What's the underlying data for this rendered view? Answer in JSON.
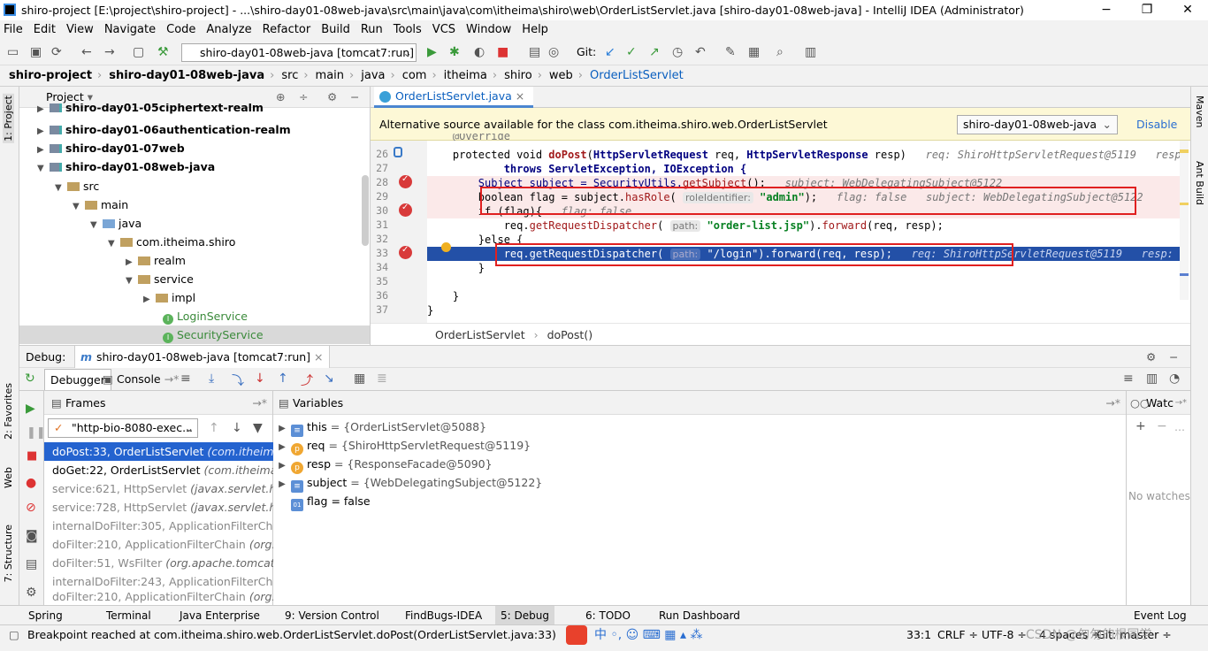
{
  "window": {
    "title": "shiro-project [E:\\project\\shiro-project] - ...\\shiro-day01-08web-java\\src\\main\\java\\com\\itheima\\shiro\\web\\OrderListServlet.java [shiro-day01-08web-java] - IntelliJ IDEA (Administrator)",
    "minimize": "−",
    "maximize": "❐",
    "close": "✕"
  },
  "menu": [
    "File",
    "Edit",
    "View",
    "Navigate",
    "Code",
    "Analyze",
    "Refactor",
    "Build",
    "Run",
    "Tools",
    "VCS",
    "Window",
    "Help"
  ],
  "toolbar": {
    "run_config": "shiro-day01-08web-java [tomcat7:run]",
    "git_label": "Git:"
  },
  "breadcrumbs": [
    "shiro-project",
    "shiro-day01-08web-java",
    "src",
    "main",
    "java",
    "com",
    "itheima",
    "shiro",
    "web",
    "OrderListServlet"
  ],
  "project": {
    "header": "Project",
    "tree": [
      {
        "label": "shiro-day01-05ciphertext-realm",
        "bold": true,
        "indent": 0
      },
      {
        "label": "shiro-day01-06authentication-realm",
        "bold": true,
        "indent": 0
      },
      {
        "label": "shiro-day01-07web",
        "bold": true,
        "indent": 0
      },
      {
        "label": "shiro-day01-08web-java",
        "bold": true,
        "indent": 0
      },
      {
        "label": "src",
        "indent": 1
      },
      {
        "label": "main",
        "indent": 2
      },
      {
        "label": "java",
        "indent": 3
      },
      {
        "label": "com.itheima.shiro",
        "indent": 4
      },
      {
        "label": "realm",
        "indent": 5
      },
      {
        "label": "service",
        "indent": 5
      },
      {
        "label": "impl",
        "indent": 6
      },
      {
        "label": "LoginService",
        "indent": 6
      },
      {
        "label": "SecurityService",
        "indent": 6
      }
    ]
  },
  "editor": {
    "tab": "OrderListServlet.java",
    "notice": "Alternative source available for the class com.itheima.shiro.web.OrderListServlet",
    "notice_select": "shiro-day01-08web-java",
    "notice_disable": "Disable",
    "line_numbers": [
      "26",
      "27",
      "28",
      "29",
      "30",
      "31",
      "32",
      "33",
      "34",
      "35",
      "36",
      "37"
    ],
    "code": {
      "l25": "    @Override",
      "l26a": "    protected void ",
      "l26b": "doPost",
      "l26c": "(",
      "l26d": "HttpServletRequest",
      "l26e": " req, ",
      "l26f": "HttpServletResponse",
      "l26g": " resp)",
      "l26h": "   req: ShiroHttpServletRequest@5119   resp: ResponseFacade@5090",
      "l27": "            throws ServletException, IOException {",
      "l28a": "        Subject subject = SecurityUtils.",
      "l28b": "getSubject",
      "l28c": "();",
      "l28d": "   subject: WebDelegatingSubject@5122",
      "l29a": "        boolean flag = subject.",
      "l29b": "hasRole",
      "l29c": "( ",
      "l29d": "roleIdentifier:",
      "l29e": " \"admin\"",
      "l29f": ");",
      "l29g": "   flag: false   subject: WebDelegatingSubject@5122",
      "l30a": "        if (flag){",
      "l30b": "   flag: false",
      "l31a": "            req.",
      "l31b": "getRequestDispatcher",
      "l31c": "( ",
      "l31d": "path:",
      "l31e": " \"order-list.jsp\"",
      "l31f": ").",
      "l31g": "forward",
      "l31h": "(req, resp);",
      "l32": "        }else {",
      "l33a": "            req.getRequestDispatcher( ",
      "l33b": "path:",
      "l33c": " \"/login\").forward(req, resp);",
      "l33d": "   req: ShiroHttpServletRequest@5119   resp: ResponseFacade@5090",
      "l34": "        }",
      "l36": "    }",
      "l37": "}"
    },
    "footer": [
      "OrderListServlet",
      "doPost()"
    ]
  },
  "debug": {
    "label": "Debug:",
    "session": "shiro-day01-08web-java [tomcat7:run]",
    "tabs": {
      "debugger": "Debugger",
      "console": "Console"
    },
    "frames_header": "Frames",
    "variables_header": "Variables",
    "watches_header": "Watc",
    "thread": "\"http-bio-8080-exec...",
    "frames": [
      {
        "method": "doPost:33, OrderListServlet",
        "pkg": "(com.itheima.sh",
        "selected": true
      },
      {
        "method": "doGet:22, OrderListServlet",
        "pkg": "(com.itheima.sh"
      },
      {
        "method": "service:621, HttpServlet",
        "pkg": "(javax.servlet.http)",
        "gray": true
      },
      {
        "method": "service:728, HttpServlet",
        "pkg": "(javax.servlet.http)",
        "gray": true
      },
      {
        "method": "internalDoFilter:305, ApplicationFilterChain",
        "pkg": "",
        "gray": true
      },
      {
        "method": "doFilter:210, ApplicationFilterChain",
        "pkg": "(org.ap",
        "gray": true
      },
      {
        "method": "doFilter:51, WsFilter",
        "pkg": "(org.apache.tomcat.we",
        "gray": true
      },
      {
        "method": "internalDoFilter:243, ApplicationFilterChain",
        "pkg": "",
        "gray": true
      },
      {
        "method": "doFilter:210, ApplicationFilterChain",
        "pkg": "(org.ap",
        "gray": true
      }
    ],
    "variables": [
      {
        "icon": "≡",
        "name": "this",
        "value": " = {OrderListServlet@5088}",
        "expand": true
      },
      {
        "icon": "p",
        "name": "req",
        "value": " = {ShiroHttpServletRequest@5119}",
        "expand": true
      },
      {
        "icon": "p",
        "name": "resp",
        "value": " = {ResponseFacade@5090}",
        "expand": true
      },
      {
        "icon": "≡",
        "name": "subject",
        "value": " = {WebDelegatingSubject@5122}",
        "expand": true
      },
      {
        "icon": "01",
        "name": "flag",
        "value": " = false",
        "expand": false
      }
    ],
    "no_watches": "No watches"
  },
  "left_tools": [
    "1: Project",
    "2: Favorites",
    "Web",
    "7: Structure"
  ],
  "right_tools": [
    "Maven",
    "Ant Build"
  ],
  "bottom_tools": [
    "Spring",
    "Terminal",
    "Java Enterprise",
    "9: Version Control",
    "FindBugs-IDEA",
    "5: Debug",
    "6: TODO",
    "Run Dashboard",
    "Event Log"
  ],
  "status": {
    "message": "Breakpoint reached at com.itheima.shiro.web.OrderListServlet.doPost(OrderListServlet.java:33)",
    "position": "33:1",
    "line_sep": "CRLF ÷",
    "encoding": "UTF-8 ÷",
    "indent": "4 spaces ÷",
    "vcs": "Git: master ÷",
    "watermark": "CSDN @匆匆的根同学"
  }
}
